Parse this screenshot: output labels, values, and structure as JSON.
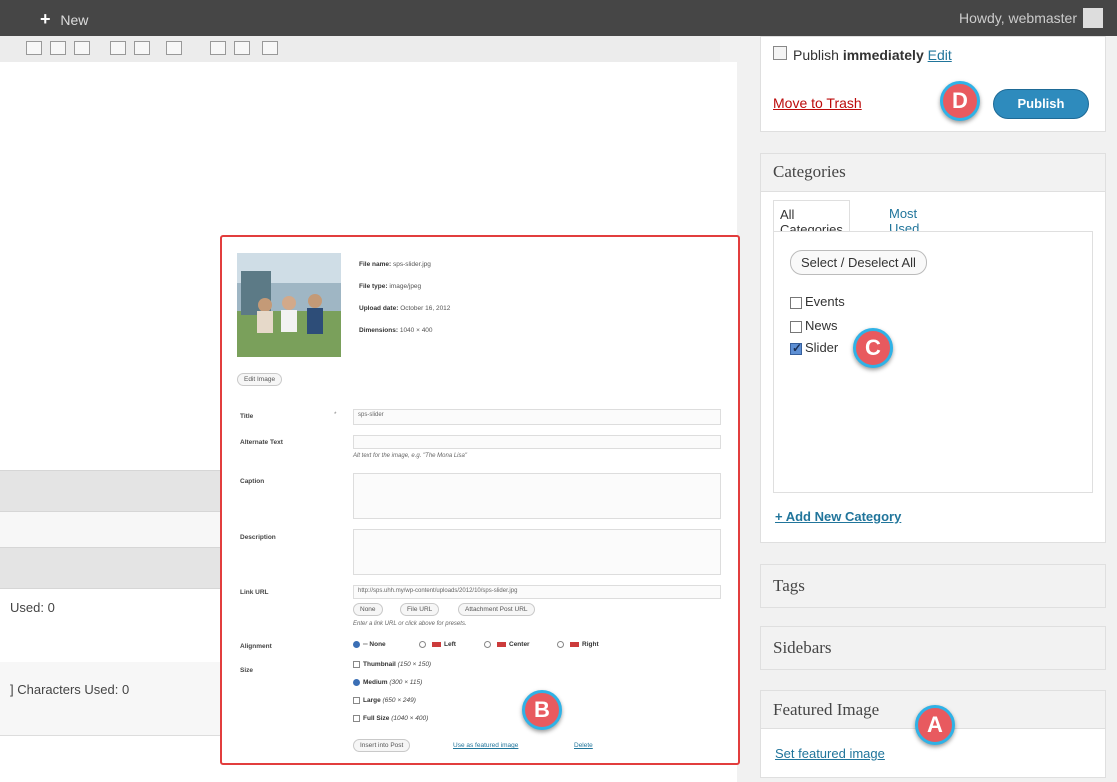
{
  "admin_bar": {
    "new_label": "New",
    "greeting": "Howdy, webmaster"
  },
  "editor": {
    "words_used_1": "Used: 0",
    "chars_used": "] Characters Used: 0"
  },
  "media": {
    "file_name_label": "File name:",
    "file_name": "sps-slider.jpg",
    "file_type_label": "File type:",
    "file_type": "image/jpeg",
    "upload_date_label": "Upload date:",
    "upload_date": "October 16, 2012",
    "dimensions_label": "Dimensions:",
    "dimensions": "1040 × 400",
    "edit_image": "Edit Image",
    "title_label": "Title",
    "title_value": "sps-slider",
    "alt_label": "Alternate Text",
    "alt_hint": "Alt text for the image, e.g. \"The Mona Lisa\"",
    "caption_label": "Caption",
    "description_label": "Description",
    "link_label": "Link URL",
    "link_value": "http://sps.uhh.my/wp-content/uploads/2012/10/sps-slider.jpg",
    "link_buttons": [
      "None",
      "File URL",
      "Attachment Post URL"
    ],
    "link_hint": "Enter a link URL or click above for presets.",
    "alignment_label": "Alignment",
    "align_options": [
      "None",
      "Left",
      "Center",
      "Right"
    ],
    "size_label": "Size",
    "sizes": [
      {
        "name": "Thumbnail",
        "dim": "(150 × 150)"
      },
      {
        "name": "Medium",
        "dim": "(300 × 115)"
      },
      {
        "name": "Large",
        "dim": "(650 × 249)"
      },
      {
        "name": "Full Size",
        "dim": "(1040 × 400)"
      }
    ],
    "insert_button": "Insert into Post",
    "featured_link": "Use as featured image",
    "delete_link": "Delete"
  },
  "publish": {
    "label_prefix": "Publish",
    "label_bold": "immediately",
    "edit": "Edit",
    "trash": "Move to Trash",
    "publish_button": "Publish"
  },
  "categories": {
    "title": "Categories",
    "tab_all": "All Categories",
    "tab_most": "Most Used",
    "select_all": "Select / Deselect All",
    "items": [
      "Events",
      "News",
      "Slider"
    ],
    "add_new": "+ Add New Category"
  },
  "tags": {
    "title": "Tags"
  },
  "sidebars": {
    "title": "Sidebars"
  },
  "featured": {
    "title": "Featured Image",
    "set_link": "Set featured image"
  },
  "callouts": {
    "a": "A",
    "b": "B",
    "c": "C",
    "d": "D"
  },
  "colors": {
    "highlight_border": "#e23d3d",
    "badge_fill": "#e85a5f",
    "badge_ring": "#2fb2e6",
    "link": "#21759b"
  }
}
